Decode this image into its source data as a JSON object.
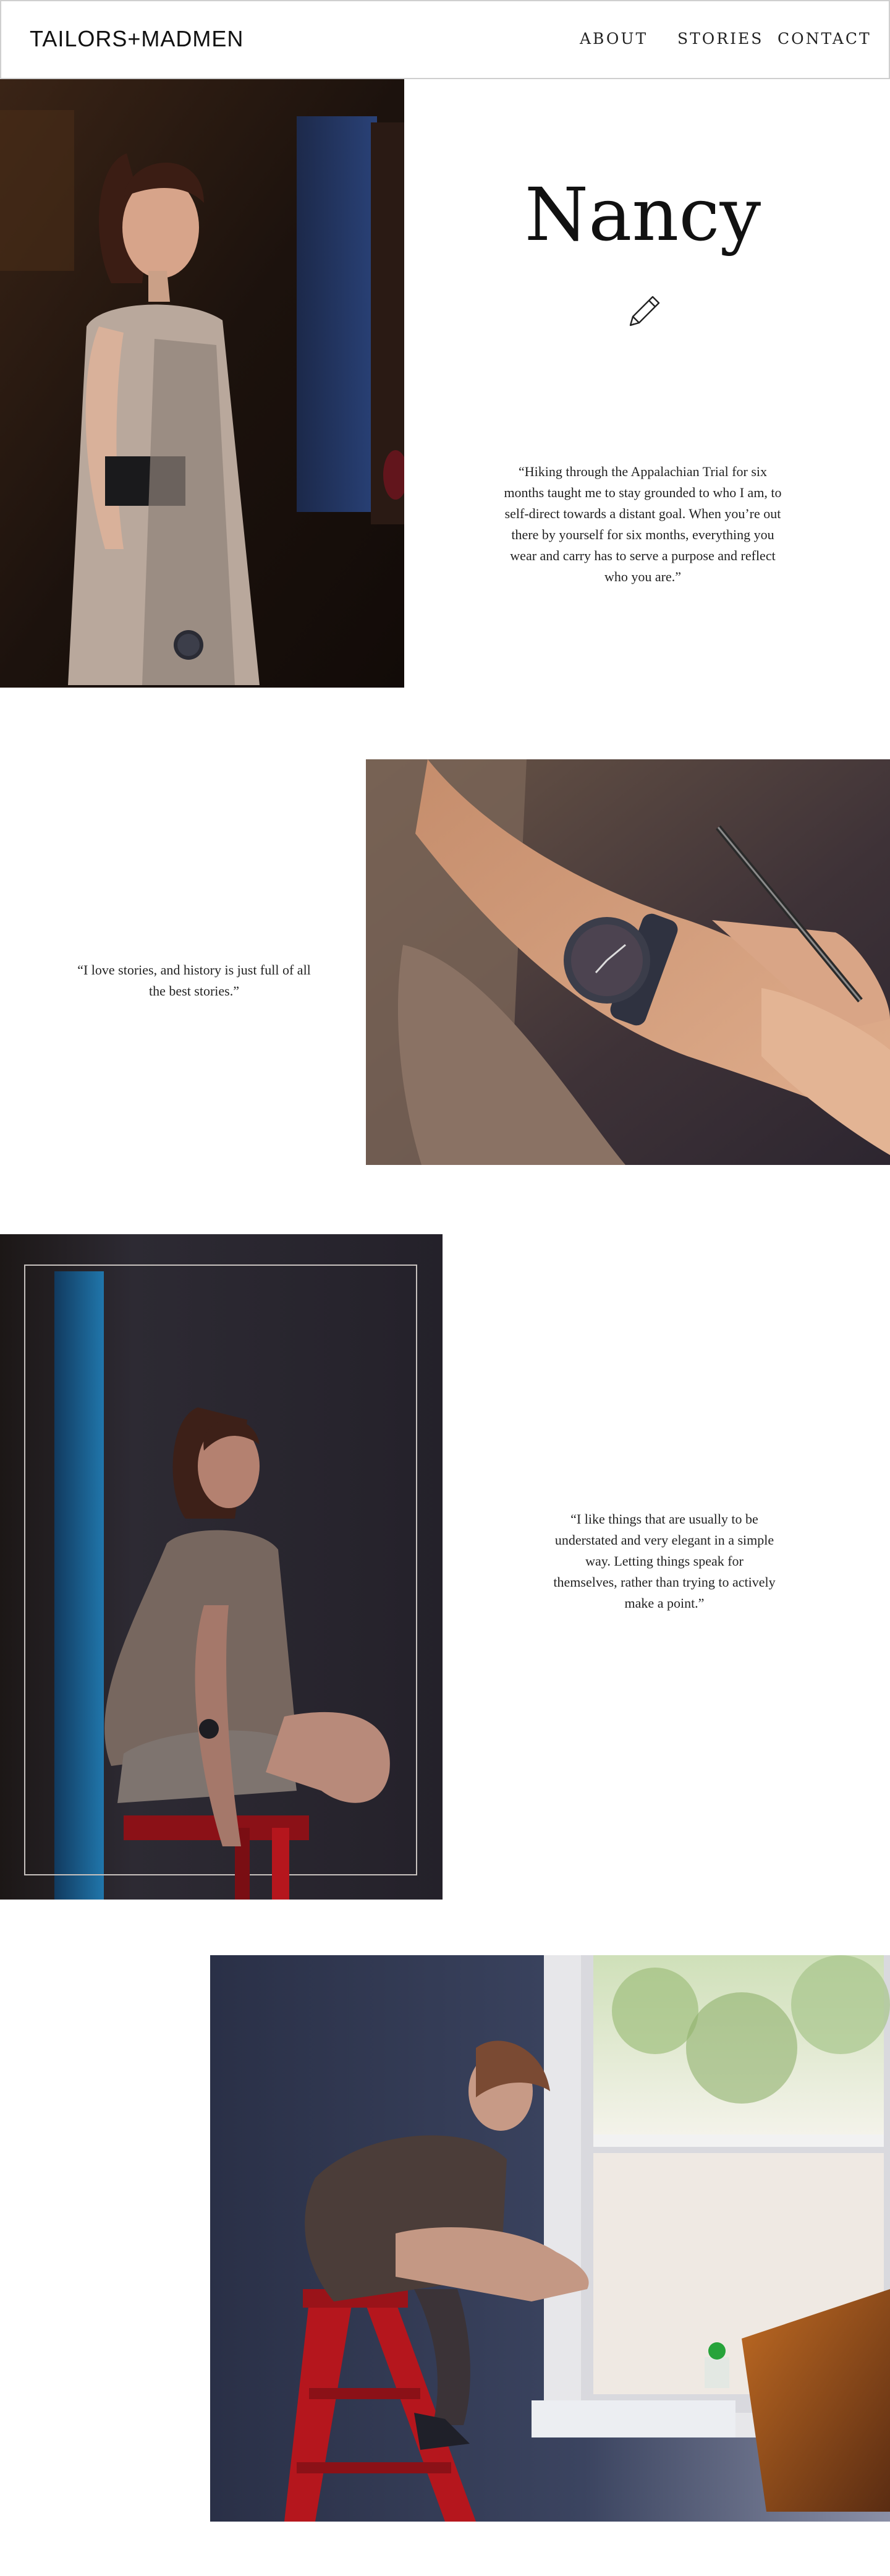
{
  "header": {
    "logo": "TAILORS+MADMEN",
    "nav": {
      "about": "ABOUT",
      "stories": "STORIES",
      "contact": "CONTACT"
    }
  },
  "profile": {
    "name": "Nancy",
    "quote_1": "“Hiking through the Appalachian Trial for six months taught me to stay grounded to who I am, to self-direct towards a distant goal. When you’re out there by yourself for six months, everything you wear and carry has to serve a purpose and reflect who you are.”",
    "quote_2": "“I love stories, and history is just full of all the best stories.”",
    "quote_3": "“I like things that are usually to be understated and very elegant in a simple way. Letting things speak for themselves, rather than trying to actively make a point.”"
  },
  "icons": {
    "pencil": "pencil-icon"
  },
  "colors": {
    "page_background": "#ffffff",
    "header_border": "#cfcfcf",
    "text": "#1e1e1e",
    "stool_red": "#b5161d"
  }
}
